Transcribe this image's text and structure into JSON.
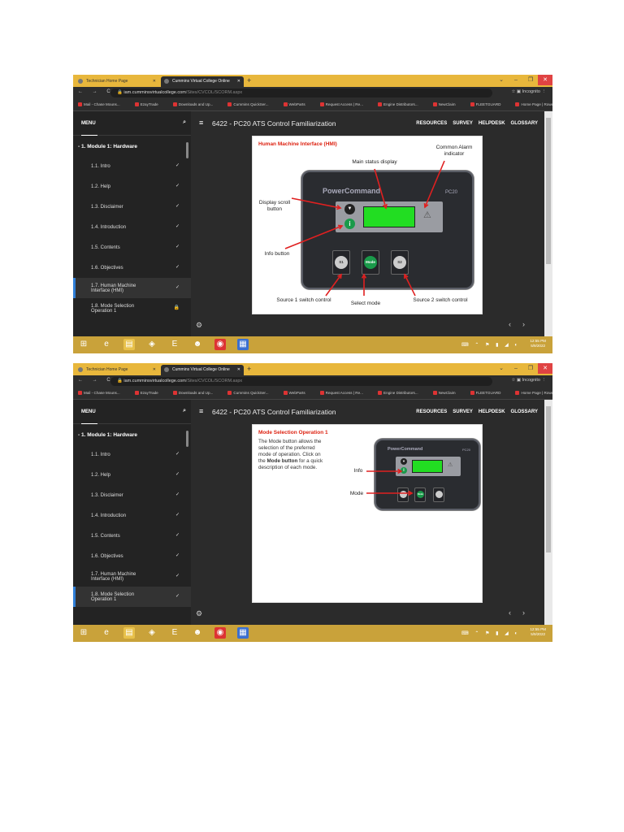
{
  "screenshots": [
    {
      "browser": {
        "tabs": [
          "Technician Home Page",
          "Cummins Virtual College Online"
        ],
        "url_host": "iam.cumminsvirtualcollege.com",
        "url_path": "/Sites/CVCOL/SCORM.aspx",
        "profile": "Incognito",
        "bookmarks": [
          "Mail - Chase Mouns...",
          "EzayTrade",
          "Downloads and Up...",
          "Cummins QuickSer...",
          "WebParts",
          "Request Access | Re...",
          "Engine Distributors...",
          "NewClaim",
          "FLEETGUARD",
          "Home Page | Rowe..."
        ]
      },
      "menu_label": "MENU",
      "module": "1. Module 1: Hardware",
      "course_title": "6422 - PC20 ATS Control Familiarization",
      "nav_links": [
        "RESOURCES",
        "SURVEY",
        "HELPDESK",
        "GLOSSARY"
      ],
      "items": [
        {
          "label": "1.1. Intro",
          "status": "✓"
        },
        {
          "label": "1.2. Help",
          "status": "✓"
        },
        {
          "label": "1.3. Disclaimer",
          "status": "✓"
        },
        {
          "label": "1.4. Introduction",
          "status": "✓"
        },
        {
          "label": "1.5. Contents",
          "status": "✓"
        },
        {
          "label": "1.6. Objectives",
          "status": "✓"
        },
        {
          "label": "1.7. Human Machine Interface (HMI)",
          "status": "✓"
        },
        {
          "label": "1.8. Mode Selection Operation 1",
          "status": "🔒"
        }
      ],
      "active_index": 6,
      "clock": {
        "time": "12:55 PM",
        "date": "5/9/2022"
      },
      "slide": {
        "type": "hmi",
        "heading": "Human Machine Interface (HMI)",
        "brand": "PowerCommand",
        "model": "PC20",
        "labels": {
          "alarm": "Common Alarm indicator",
          "display": "Main status display",
          "scroll": "Display scroll button",
          "info": "Info button",
          "s1": "Source 1 switch control",
          "mode": "Select mode",
          "s2": "Source 2 switch control"
        },
        "buttons": {
          "s1": "S1",
          "mode": "Mode",
          "s2": "S2",
          "info": "i"
        }
      }
    },
    {
      "browser": {
        "tabs": [
          "Technician Home Page",
          "Cummins Virtual College Online"
        ],
        "url_host": "iam.cumminsvirtualcollege.com",
        "url_path": "/Sites/CVCOL/SCORM.aspx",
        "profile": "Incognito",
        "bookmarks": [
          "Mail - Chase Mouns...",
          "EzayTrade",
          "Downloads and Up...",
          "Cummins QuickSer...",
          "WebParts",
          "Request Access | Re...",
          "Engine Distributors...",
          "NewClaim",
          "FLEETGUARD",
          "Home Page | Rowe..."
        ]
      },
      "menu_label": "MENU",
      "module": "1. Module 1: Hardware",
      "course_title": "6422 - PC20 ATS Control Familiarization",
      "nav_links": [
        "RESOURCES",
        "SURVEY",
        "HELPDESK",
        "GLOSSARY"
      ],
      "items": [
        {
          "label": "1.1. Intro",
          "status": "✓"
        },
        {
          "label": "1.2. Help",
          "status": "✓"
        },
        {
          "label": "1.3. Disclaimer",
          "status": "✓"
        },
        {
          "label": "1.4. Introduction",
          "status": "✓"
        },
        {
          "label": "1.5. Contents",
          "status": "✓"
        },
        {
          "label": "1.6. Objectives",
          "status": "✓"
        },
        {
          "label": "1.7. Human Machine Interface (HMI)",
          "status": "✓"
        },
        {
          "label": "1.8. Mode Selection Operation 1",
          "status": "✓"
        }
      ],
      "active_index": 7,
      "clock": {
        "time": "12:55 PM",
        "date": "5/9/2022"
      },
      "slide": {
        "type": "mode",
        "heading": "Mode Selection Operation 1",
        "text_before": "The Mode button allows the selection of the preferred mode of operation. Click on the ",
        "text_bold": "Mode button",
        "text_after": " for a quick description of each mode.",
        "brand": "PowerCommand",
        "model": "PC20",
        "labels": {
          "info": "Info",
          "mode": "Mode"
        },
        "buttons": {
          "mode": "Mode",
          "info": "i"
        }
      }
    }
  ]
}
